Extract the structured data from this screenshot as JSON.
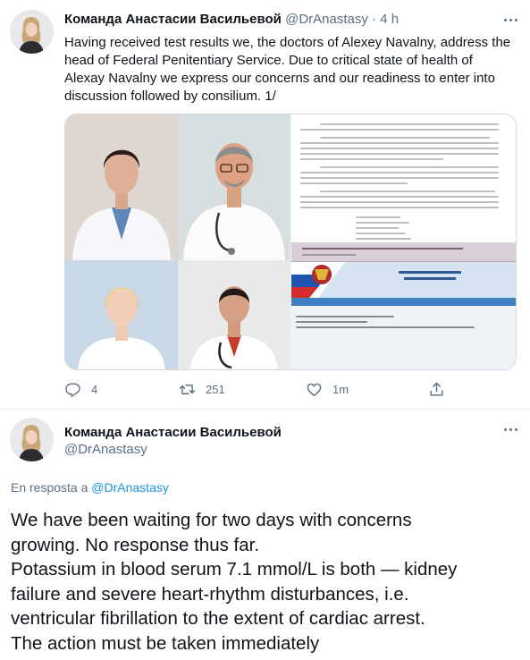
{
  "tweet": {
    "author_name": "Команда Анастасии Васильевой",
    "handle": "@DrAnastasy",
    "separator": "·",
    "time": "4 h",
    "text": "Having received test results we, the doctors of Alexey Navalny, address the head of Federal Penitentiary Service. Due to critical state of health of Alexay Navalny we express our concerns and our readiness to enter into discussion followed by consilium. 1/",
    "actions": {
      "reply_count": "4",
      "retweet_count": "251",
      "like_count": "1m"
    }
  },
  "reply_tweet": {
    "author_name": "Команда Анастасии Васильевой",
    "handle": "@DrAnastasy",
    "replying_prefix": "En resposta a",
    "replying_to": "@DrAnastasy",
    "lines": [
      "We have been waiting for two days with concerns",
      "growing. No response thus far.",
      "Potassium in blood serum 7.1 mmol/L is both — kidney",
      "failure and severe heart-rhythm disturbances, i.e.",
      "ventricular fibrillation to the extent of cardiac arrest.",
      "The action must be taken immediately"
    ]
  },
  "icons": [
    "more-icon",
    "reply-icon",
    "retweet-icon",
    "like-icon",
    "share-icon"
  ],
  "colors": {
    "text": "#0f1419",
    "secondary": "#5b7083",
    "link": "#1b95e0",
    "border": "#ebeef0"
  }
}
